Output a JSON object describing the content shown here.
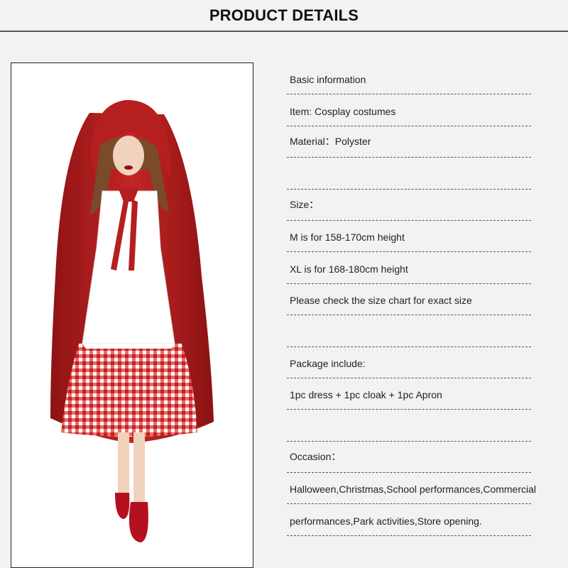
{
  "header": {
    "title": "PRODUCT DETAILS"
  },
  "product_image": {
    "icon": "costume-model-illustration"
  },
  "details": {
    "rows": [
      "Basic information",
      "Item: Cosplay costumes",
      "Material：Polyster",
      "",
      "Size：",
      "M is for 158-170cm height",
      "XL is for 168-180cm height",
      "Please check the size chart for exact size",
      "",
      "Package include:",
      "1pc dress + 1pc cloak + 1pc Apron",
      "",
      "Occasion：",
      "Halloween,Christmas,School performances,Commercial",
      "performances,Park activities,Store opening."
    ]
  },
  "colors": {
    "cloak": "#b01c1c",
    "cloak_dark": "#7e1010",
    "apron": "#ffffff",
    "gingham": "#d32626",
    "background": "#f2f2f2"
  }
}
